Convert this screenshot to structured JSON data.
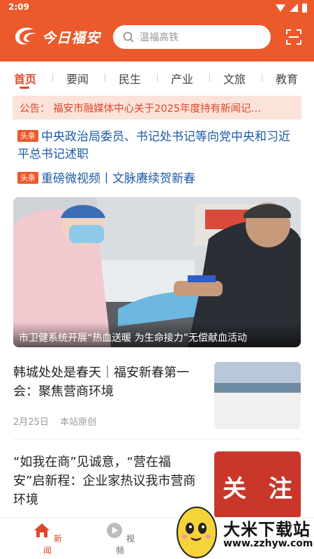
{
  "status_bar": {
    "time": "2:09"
  },
  "header": {
    "logo_text": "今日福安",
    "search_placeholder": "温福高铁"
  },
  "tabs": [
    "首页",
    "要闻",
    "民生",
    "产业",
    "文旅",
    "教育"
  ],
  "notice": {
    "text": "公告：  福安市融媒体中心关于2025年度持有新闻记…"
  },
  "headlines": [
    {
      "tag": "头条",
      "text": "中央政治局委员、书记处书记等向党中央和习近平总书记述职"
    },
    {
      "tag": "头条",
      "text": "重磅微视频丨文脉赓续贺新春"
    }
  ],
  "hero": {
    "caption": "市卫健系统开展“热血送暖 为生命接力”无偿献血活动"
  },
  "articles": [
    {
      "title": "韩城处处是春天｜福安新春第一会：聚焦营商环境",
      "date": "2月25日",
      "source": "本站原创"
    },
    {
      "title": "“如我在商”见诚意，“营在福安”启新程：企业家热议我市营商环境",
      "thumb_text": "关 注"
    }
  ],
  "bottom_nav": [
    {
      "label": "新闻",
      "icon": "home-icon"
    },
    {
      "label": "视频",
      "icon": "play-icon"
    }
  ],
  "watermark": {
    "name": "大米下载站",
    "url": "www.zzhyw.com"
  },
  "colors": {
    "brand": "#ec5a2b",
    "accent": "#e0472a",
    "headline_blue": "#1b5aa6",
    "notice_bg": "#fbe3d9"
  }
}
